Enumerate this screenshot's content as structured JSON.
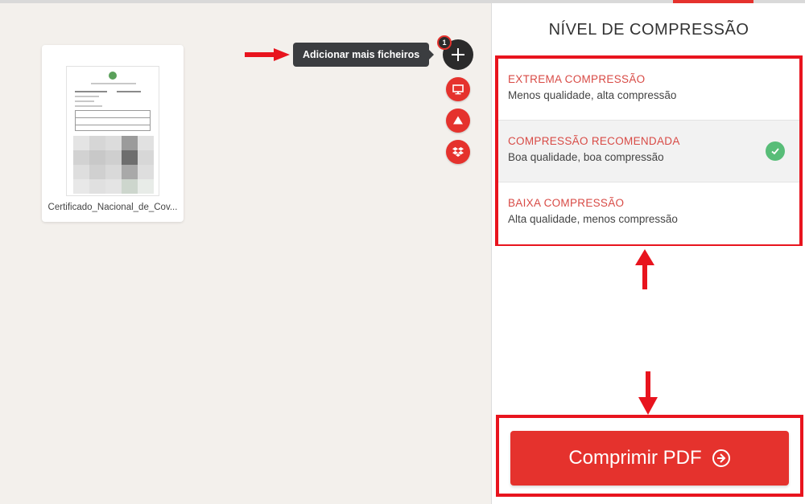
{
  "workspace": {
    "file": {
      "name": "Certificado_Nacional_de_Cov..."
    },
    "tooltip": "Adicionar mais ficheiros",
    "file_count": "1",
    "add_button_icon": "plus-icon",
    "sources": [
      {
        "icon": "computer-icon",
        "name": "source-computer-button"
      },
      {
        "icon": "google-drive-icon",
        "name": "source-google-drive-button"
      },
      {
        "icon": "dropbox-icon",
        "name": "source-dropbox-button"
      }
    ]
  },
  "sidebar": {
    "title": "NÍVEL DE COMPRESSÃO",
    "options": [
      {
        "title": "EXTREMA COMPRESSÃO",
        "description": "Menos qualidade, alta compressão",
        "selected": false
      },
      {
        "title": "COMPRESSÃO RECOMENDADA",
        "description": "Boa qualidade, boa compressão",
        "selected": true
      },
      {
        "title": "BAIXA COMPRESSÃO",
        "description": "Alta qualidade, menos compressão",
        "selected": false
      }
    ],
    "cta_label": "Comprimir PDF"
  },
  "colors": {
    "brand": "#e5322d",
    "annotation": "#e8141e",
    "check": "#58bd78",
    "tooltip_bg": "#3b3d40"
  }
}
